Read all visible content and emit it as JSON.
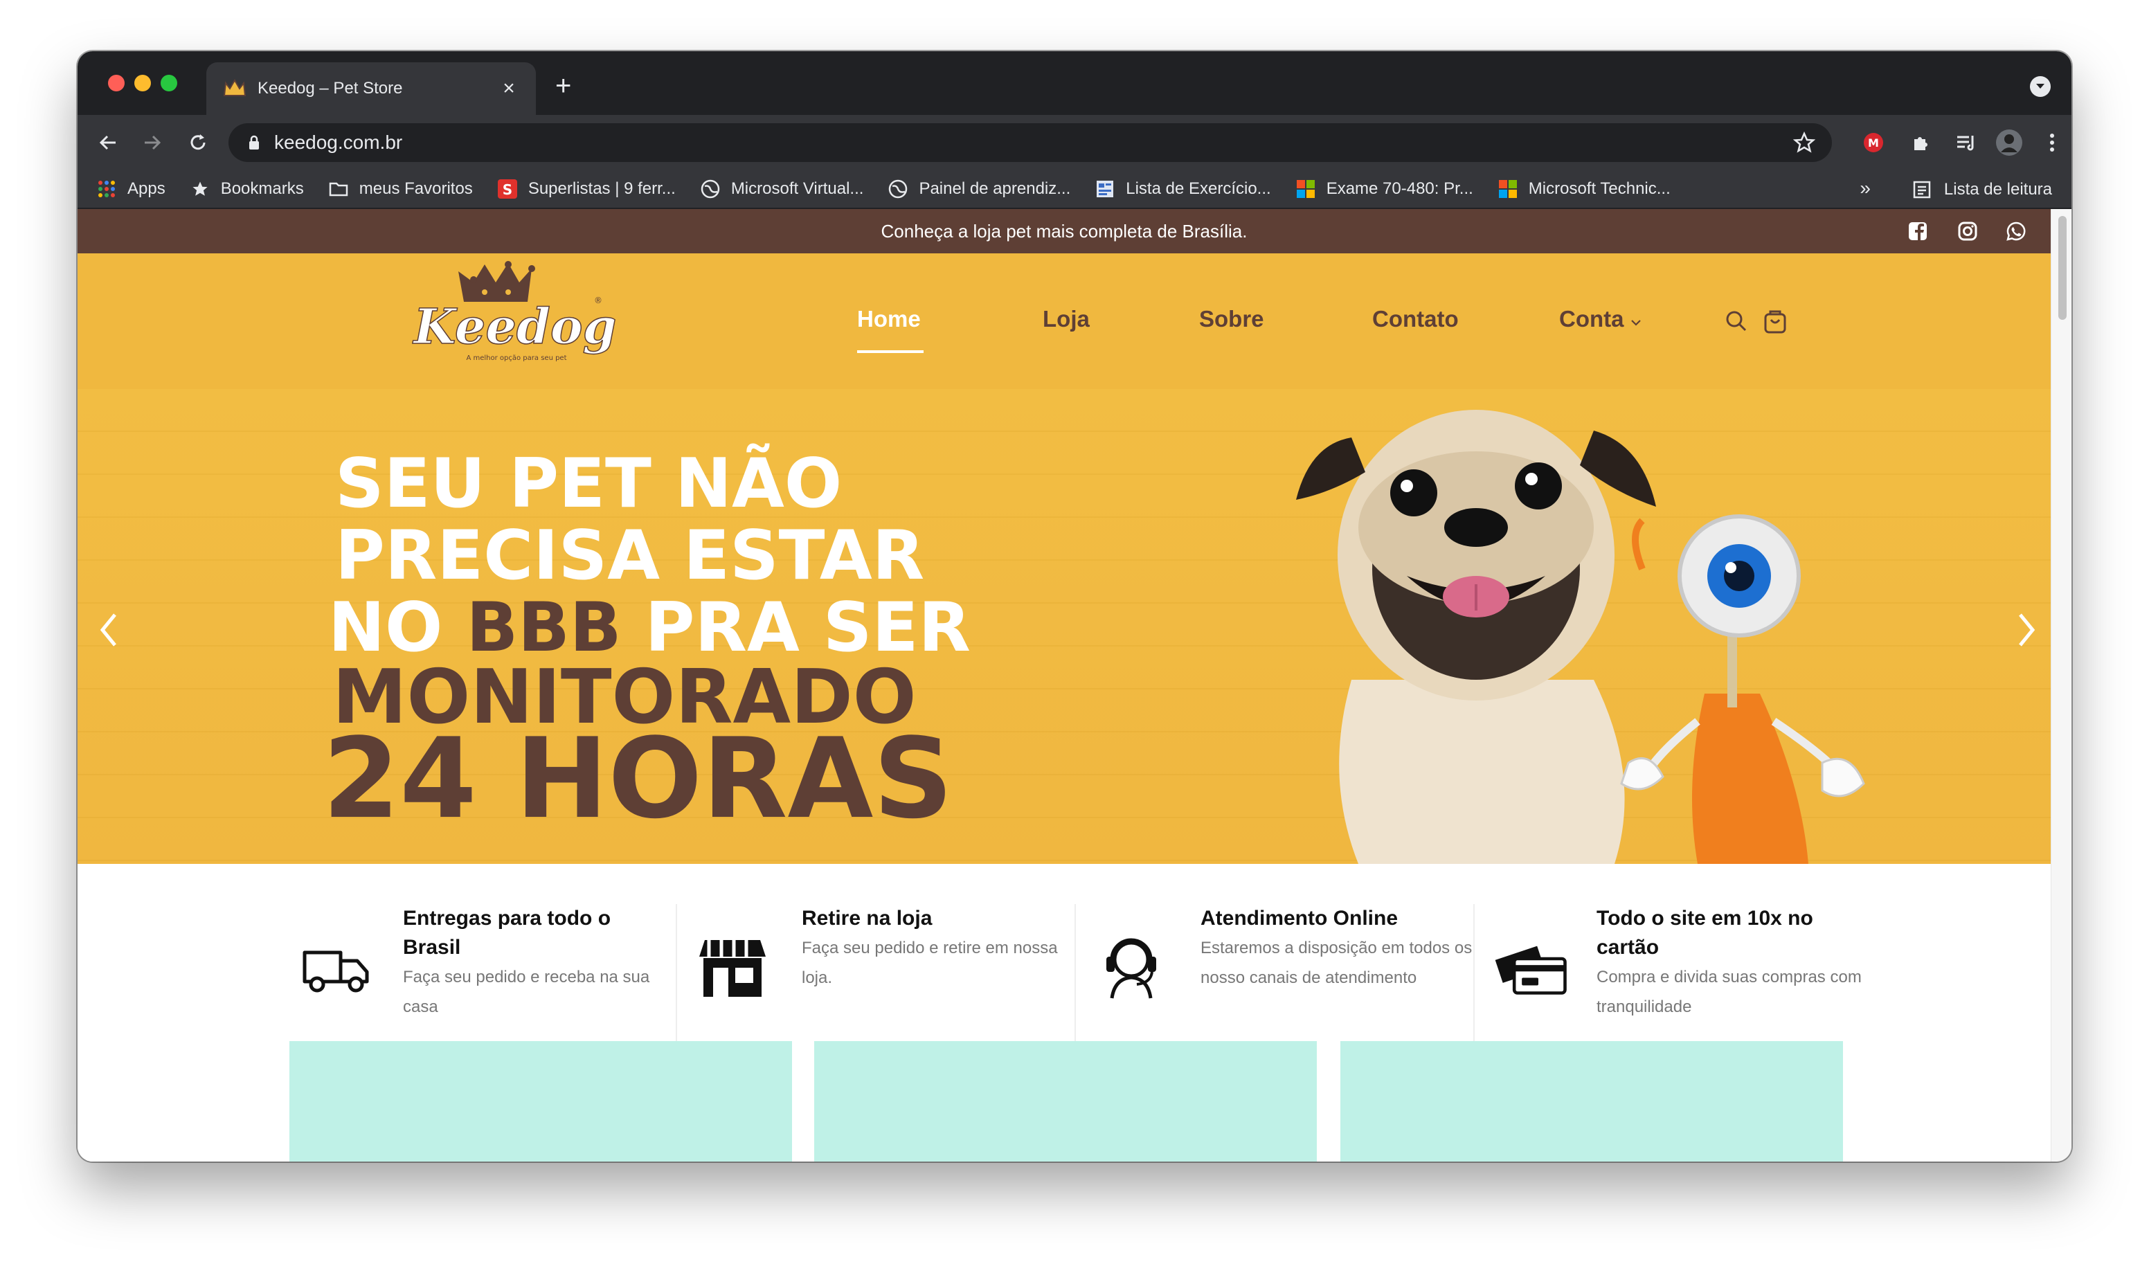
{
  "browser": {
    "tab_title": "Keedog – Pet Store",
    "url": "keedog.com.br",
    "bookmarks": [
      {
        "label": "Apps",
        "icon": "apps-grid-icon"
      },
      {
        "label": "Bookmarks",
        "icon": "star-icon"
      },
      {
        "label": "meus Favoritos",
        "icon": "folder-icon"
      },
      {
        "label": "Superlistas | 9 ferr...",
        "icon": "superlistas-icon"
      },
      {
        "label": "Microsoft Virtual...",
        "icon": "globe-icon"
      },
      {
        "label": "Painel de aprendiz...",
        "icon": "globe-icon"
      },
      {
        "label": "Lista de Exercício...",
        "icon": "document-icon"
      },
      {
        "label": "Exame 70-480: Pr...",
        "icon": "microsoft-icon"
      },
      {
        "label": "Microsoft Technic...",
        "icon": "microsoft-icon"
      }
    ],
    "overflow_label": "»",
    "reading_list": "Lista de leitura"
  },
  "site": {
    "announcement": "Conheça a loja pet mais completa de Brasília.",
    "logo_text": "Keedog",
    "logo_tagline": "A melhor opção para seu pet",
    "nav": [
      {
        "label": "Home",
        "active": true
      },
      {
        "label": "Loja",
        "active": false
      },
      {
        "label": "Sobre",
        "active": false
      },
      {
        "label": "Contato",
        "active": false
      },
      {
        "label": "Conta",
        "active": false
      }
    ],
    "hero_lines": [
      "SEU PET NÃO",
      "PRECISA ESTAR",
      "NO ",
      "BBB",
      " PRA SER",
      "MONITORADO",
      "24 HORAS"
    ],
    "colors": {
      "brand_brown": "#5e3f35",
      "brand_yellow": "#f0b83f",
      "card_mint": "#bff1e7"
    },
    "features": [
      {
        "title": "Entregas para todo o Brasil",
        "desc": "Faça seu pedido e receba na sua casa",
        "icon": "delivery-truck-icon"
      },
      {
        "title": "Retire na loja",
        "desc": "Faça seu pedido e retire em nossa loja.",
        "icon": "store-icon"
      },
      {
        "title": "Atendimento Online",
        "desc": "Estaremos a disposição em todos os nosso canais de atendimento",
        "icon": "headset-support-icon"
      },
      {
        "title": "Todo o site em 10x no cartão",
        "desc": "Compra e divida suas compras com tranquilidade",
        "icon": "credit-card-icon"
      }
    ]
  }
}
